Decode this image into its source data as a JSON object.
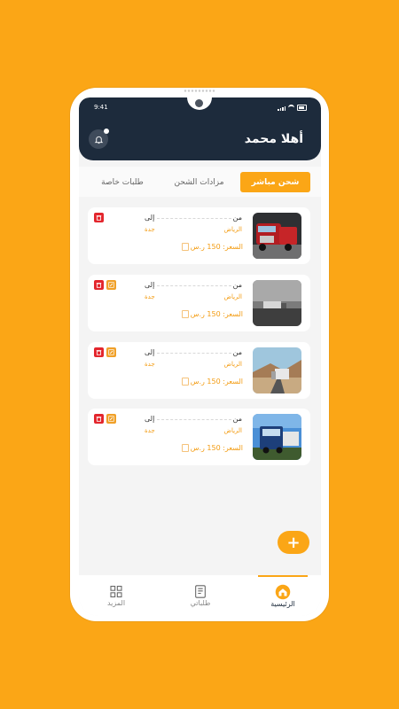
{
  "status_bar": {
    "time": "9:41"
  },
  "header": {
    "greeting": "أهلا محمد",
    "notification_icon": "bell-icon"
  },
  "tabs": [
    {
      "label": "شحن مباشر",
      "active": true
    },
    {
      "label": "مزادات الشحن",
      "active": false
    },
    {
      "label": "طلبات خاصة",
      "active": false
    }
  ],
  "orders": [
    {
      "from_label": "من",
      "to_label": "إلى",
      "from_city": "الرياض",
      "to_city": "جدة",
      "price": "السعر: 150 ر.س",
      "thumb": "red-truck",
      "edit": false
    },
    {
      "from_label": "من",
      "to_label": "إلى",
      "from_city": "الرياض",
      "to_city": "جدة",
      "price": "السعر: 150 ر.س",
      "thumb": "foggy-road-truck",
      "edit": true
    },
    {
      "from_label": "من",
      "to_label": "إلى",
      "from_city": "الرياض",
      "to_city": "جدة",
      "price": "السعر: 150 ر.س",
      "thumb": "desert-highway-truck",
      "edit": true
    },
    {
      "from_label": "من",
      "to_label": "إلى",
      "from_city": "الرياض",
      "to_city": "جدة",
      "price": "السعر: 150 ر.س",
      "thumb": "blue-truck",
      "edit": true
    }
  ],
  "fab": {
    "label": "+"
  },
  "bottom_nav": [
    {
      "label": "الرئيسية",
      "icon": "home-icon",
      "active": true
    },
    {
      "label": "طلباتي",
      "icon": "orders-icon",
      "active": false
    },
    {
      "label": "المزيد",
      "icon": "grid-icon",
      "active": false
    }
  ],
  "colors": {
    "accent": "#fba616",
    "header": "#1d2b3c",
    "delete": "#e3262d",
    "edit": "#f0a028"
  }
}
